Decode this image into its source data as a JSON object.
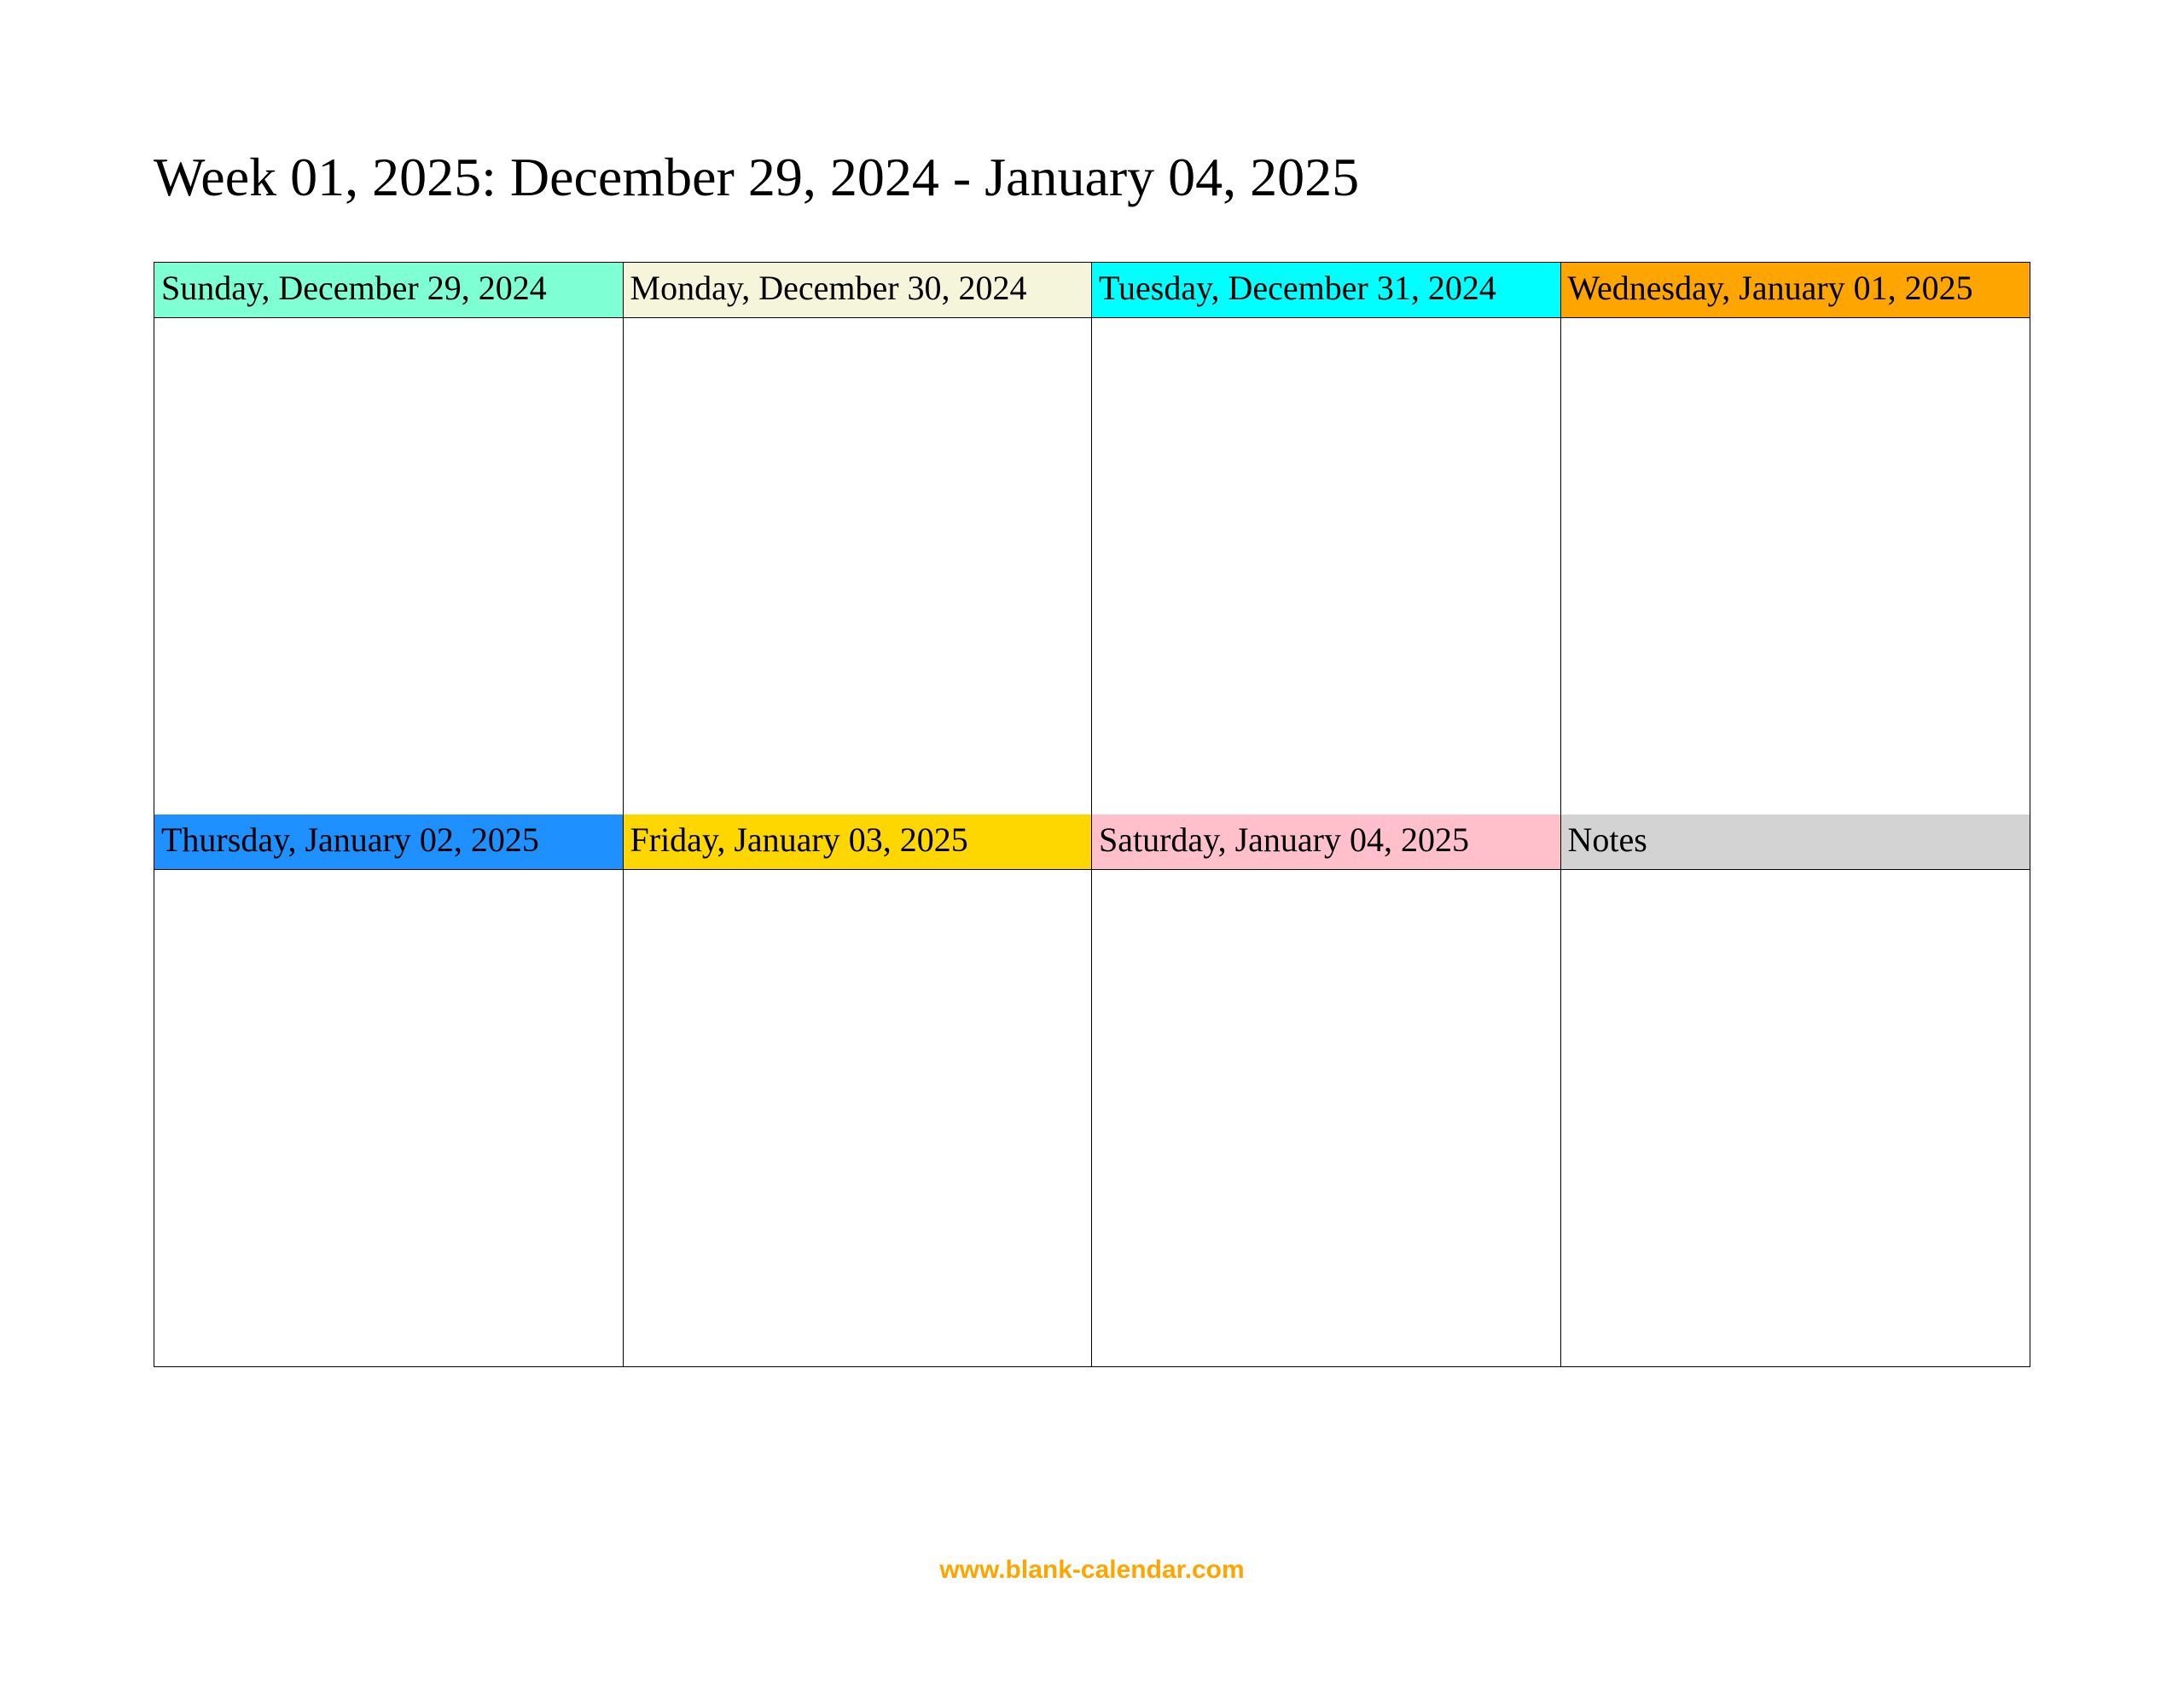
{
  "title": "Week 01, 2025: December 29, 2024 - January 04, 2025",
  "cells": {
    "sun": "Sunday, December 29, 2024",
    "mon": "Monday, December 30, 2024",
    "tue": "Tuesday, December 31, 2024",
    "wed": "Wednesday, January 01, 2025",
    "thu": "Thursday, January 02, 2025",
    "fri": "Friday, January 03, 2025",
    "sat": "Saturday, January 04, 2025",
    "notes": "Notes"
  },
  "footer_link": "www.blank-calendar.com"
}
